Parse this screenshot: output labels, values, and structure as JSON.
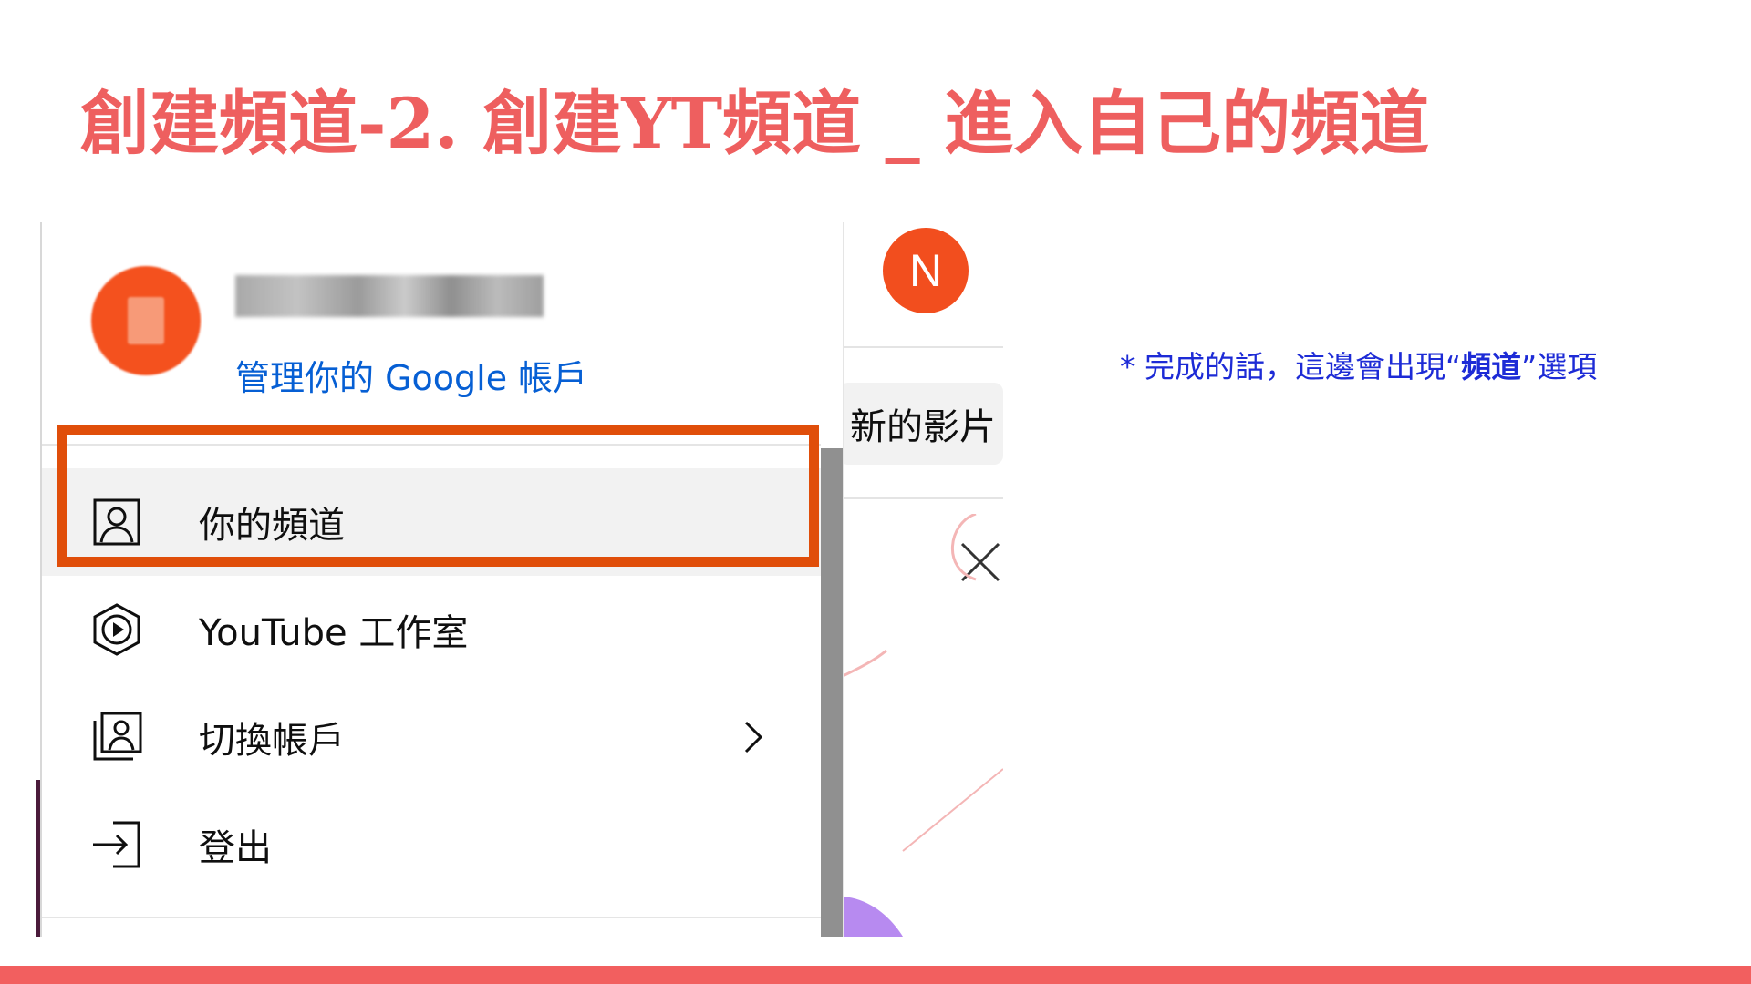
{
  "slide": {
    "title": "創建頻道-2. 創建YT頻道 _ 進入自己的頻道"
  },
  "header": {
    "avatar_letter": "N"
  },
  "background_chip": {
    "label": "新的影片"
  },
  "account_menu": {
    "user_name": "Hanako頻道名稱",
    "manage_link": "管理你的 Google 帳戶",
    "items": [
      {
        "label": "你的頻道",
        "icon": "person-box-icon"
      },
      {
        "label": "YouTube 工作室",
        "icon": "studio-hexagon-icon"
      },
      {
        "label": "切換帳戶",
        "icon": "switch-account-icon"
      },
      {
        "label": "登出",
        "icon": "sign-out-icon"
      }
    ]
  },
  "annotation": {
    "note_prefix": "* 完成的話，這邊會出現“",
    "note_bold": "頻道",
    "note_suffix": "”選項"
  },
  "colors": {
    "title": "#ee5f5f",
    "highlight_border": "#e04e0a",
    "link": "#065fd4",
    "note": "#1d2bd6",
    "bottom_bar": "#f25f5f",
    "avatar": "#f24e1e"
  }
}
